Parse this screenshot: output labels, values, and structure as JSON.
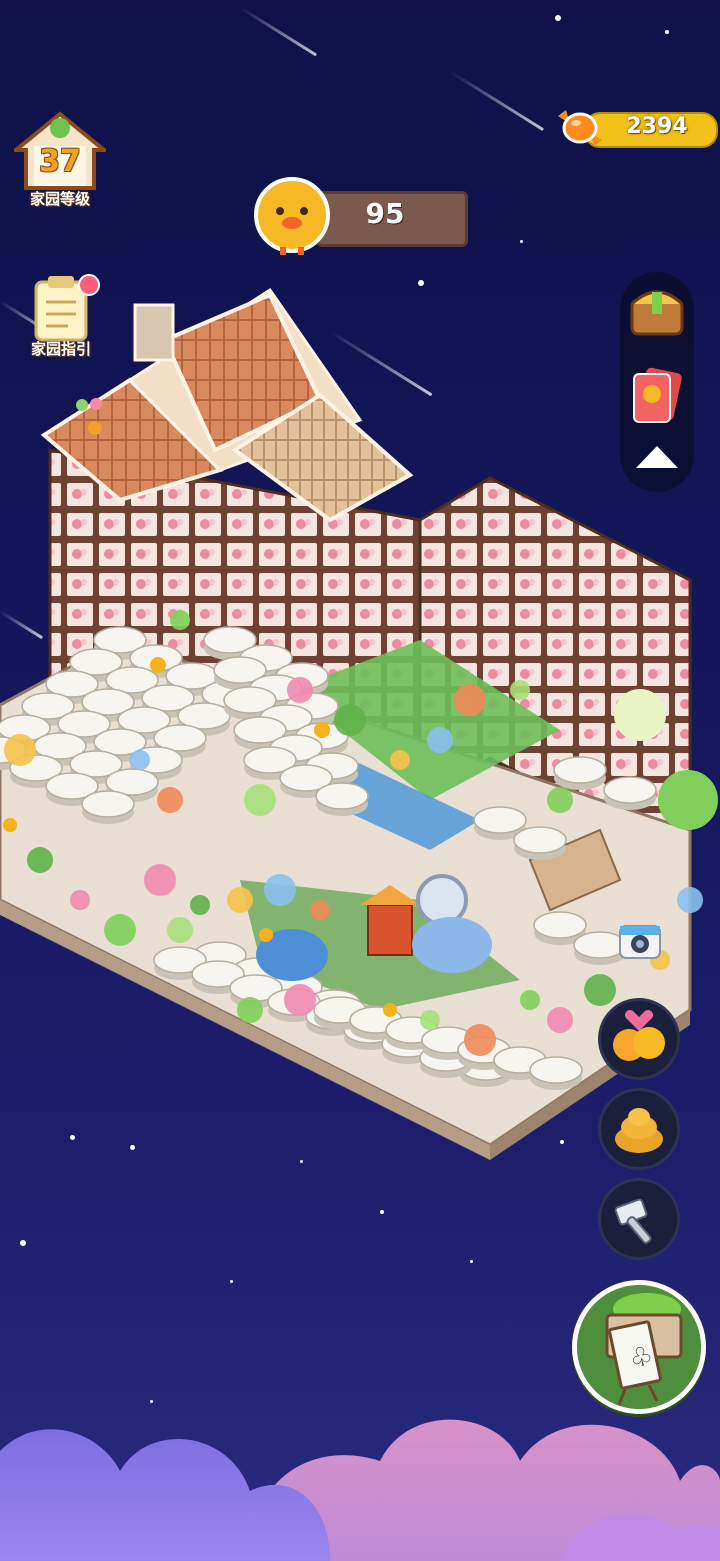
{
  "hud": {
    "home_level": {
      "value": "37",
      "label": "家园等级",
      "icon": "house-icon"
    },
    "home_guide": {
      "label": "家园指引",
      "icon": "notepad-icon",
      "has_notification": true
    },
    "currency": {
      "value": "2394",
      "icon": "candy-icon"
    },
    "ducks": {
      "value": "95",
      "icon": "yellow-duck-icon"
    }
  },
  "side_menu": {
    "items": [
      {
        "name": "shop-chest",
        "icon": "chest-icon"
      },
      {
        "name": "duck-cards",
        "icon": "cards-icon"
      },
      {
        "name": "collapse",
        "icon": "triangle-up-icon"
      }
    ]
  },
  "action_buttons": [
    {
      "name": "duck-love",
      "icon": "ducks-heart-icon"
    },
    {
      "name": "duck-pile",
      "icon": "duck-pile-icon"
    },
    {
      "name": "hammer",
      "icon": "hammer-icon"
    }
  ],
  "build_button": {
    "icon": "signboard-club-icon"
  },
  "camera_button": {
    "icon": "camera-icon"
  },
  "colors": {
    "sky_top": "#0f1148",
    "gold": "#f2c21a",
    "plank": "#7b5a4d",
    "brick_wall": "#7a4a3a",
    "floor": "#e9dfd2",
    "table_white": "#f4f4ee"
  }
}
